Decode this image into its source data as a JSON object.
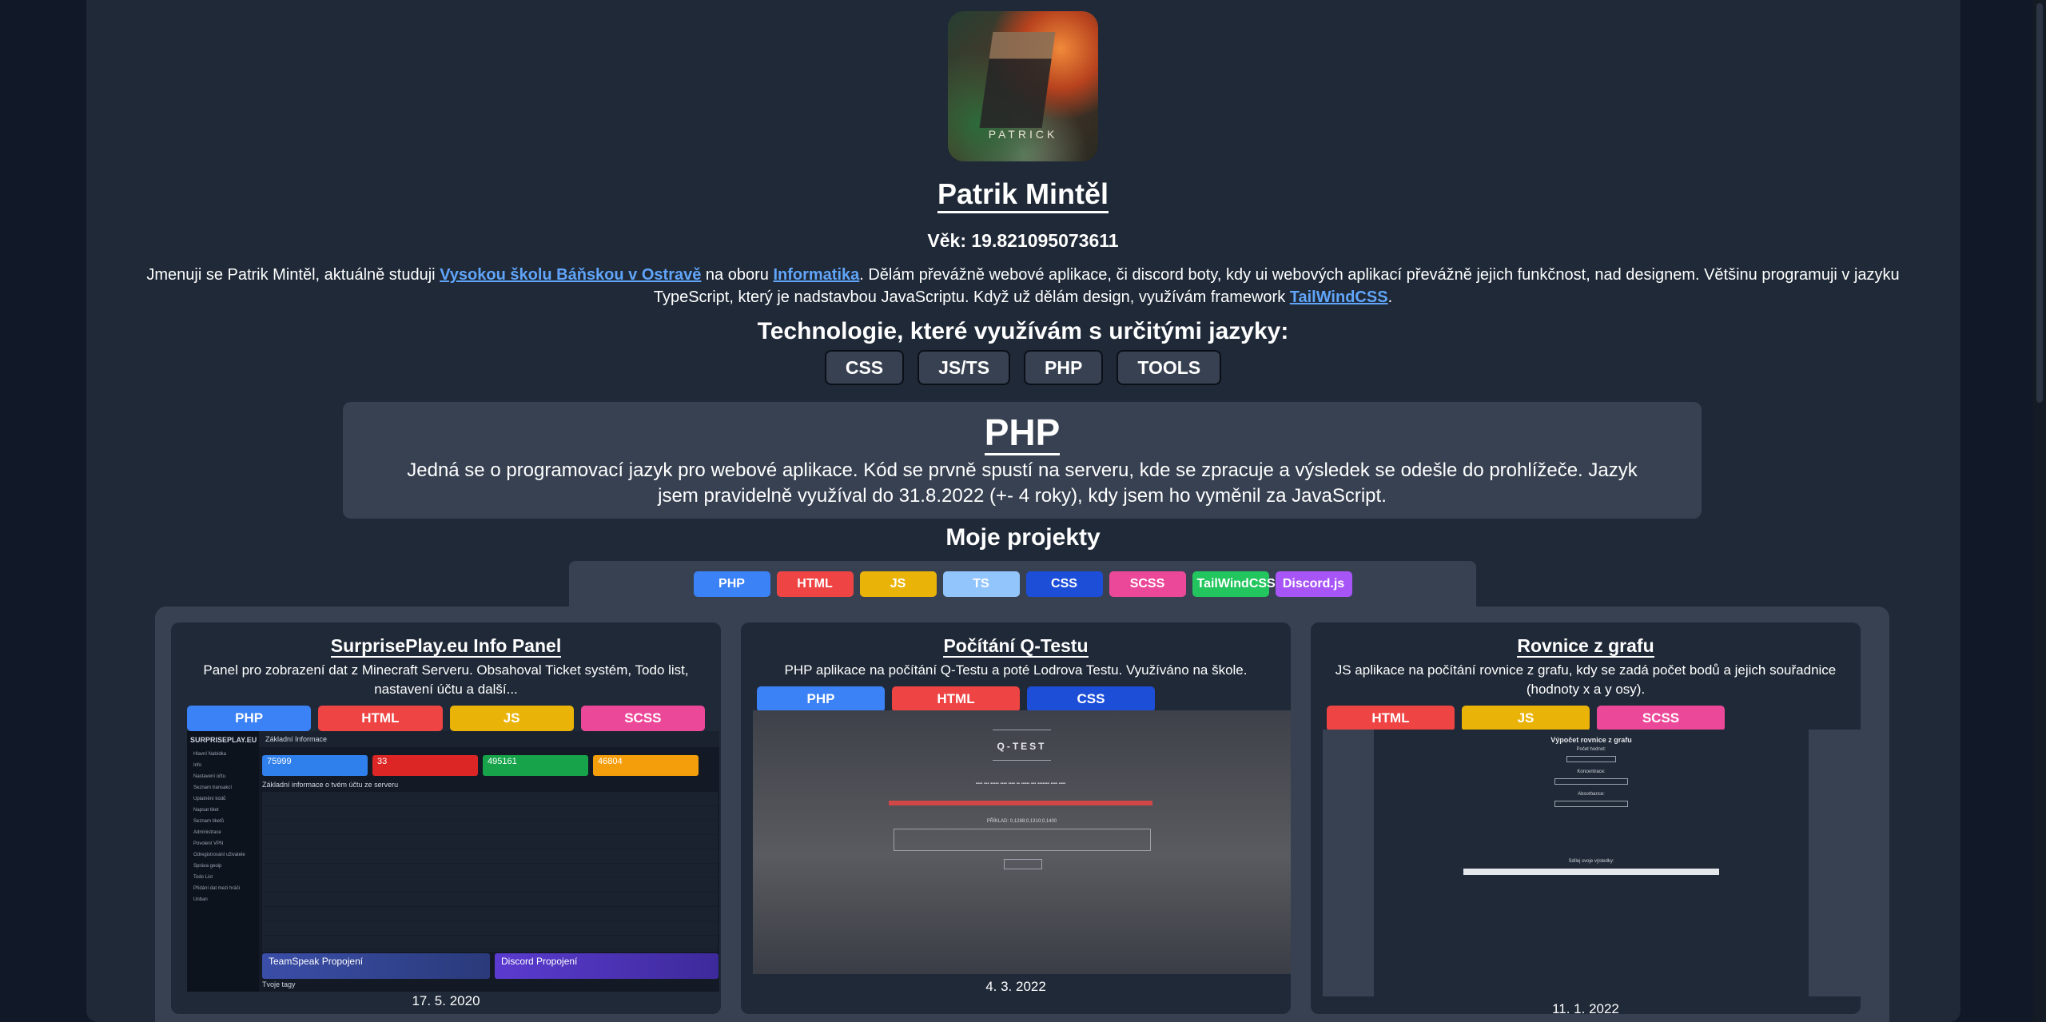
{
  "profile": {
    "avatar_caption": "PATRICK",
    "name": "Patrik Mintěl",
    "age_label": "Věk: 19.821095073611",
    "bio_part1": "Jmenuji se Patrik Mintěl, aktuálně studuji ",
    "bio_link1": "Vysokou školu Báňskou v Ostravě",
    "bio_part2": " na oboru ",
    "bio_link2": "Informatika",
    "bio_part3": ". Dělám převážně webové aplikace, či discord boty, kdy ui webových aplikací převážně jejich funkčnost, nad designem. Většinu programuji v jazyku TypeScript, který je nadstavbou JavaScriptu. Když už dělám design, využívám framework ",
    "bio_link3": "TailWindCSS",
    "bio_part4": "."
  },
  "technologies": {
    "title": "Technologie, které využívám s určitými jazyky:",
    "buttons": [
      "CSS",
      "JS/TS",
      "PHP",
      "TOOLS"
    ]
  },
  "selected_tech": {
    "title": "PHP",
    "description": "Jedná se o programovací jazyk pro webové aplikace. Kód se prvně spustí na serveru, kde se zpracuje a výsledek se odešle do prohlížeče. Jazyk jsem pravidelně využíval do 31.8.2022 (+- 4 roky), kdy jsem ho vyměnil za JavaScript."
  },
  "projects": {
    "title": "Moje projekty",
    "filters": [
      "PHP",
      "HTML",
      "JS",
      "TS",
      "CSS",
      "SCSS",
      "TailWindCSS",
      "Discord.js"
    ],
    "cards": [
      {
        "title": "SurprisePlay.eu Info Panel",
        "description": "Panel pro zobrazení dat z Minecraft Serveru. Obsahoval Ticket systém, Todo list, nastavení účtu a další...",
        "tags": [
          "PHP",
          "HTML",
          "JS",
          "SCSS"
        ],
        "date": "17. 5. 2020",
        "screenshot": {
          "brand": "SURPRISEPLAY.EU",
          "header": "Základní Informace",
          "menu": [
            "Hlavní Nabídka",
            "Info",
            "Nastavení účtu",
            "Seznam transakcí",
            "Uplatnění kódů",
            "Napsat tiket",
            "Seznam tiketů",
            "Administrace",
            "Povolení VPN",
            "Odregistrování uživatele",
            "Správa geoip",
            "Todo List",
            "Přidání dat mezi hráči",
            "Unban"
          ],
          "stats": [
            "75999",
            "33",
            "495161",
            "46804"
          ],
          "info_title": "Základní informace o tvém účtu ze serveru",
          "teamspeak": "TeamSpeak Propojení",
          "discord": "Discord Propojení",
          "tags_label": "Tvoje tagy"
        }
      },
      {
        "title": "Počítání Q-Testu",
        "description": "PHP aplikace na počítání Q-Testu a poté Lodrova Testu. Využíváno na škole.",
        "tags": [
          "PHP",
          "HTML",
          "CSS"
        ],
        "date": "4. 3. 2022",
        "screenshot": {
          "title": "Q-TEST",
          "example": "PŘÍKLAD: 0,1288;0,1310;0,1400"
        }
      },
      {
        "title": "Rovnice z grafu",
        "description": "JS aplikace na počítání rovnice z grafu, kdy se zadá počet bodů a jejich souřadnice (hodnoty x a y osy).",
        "tags": [
          "HTML",
          "JS",
          "SCSS"
        ],
        "date": "11. 1. 2022",
        "screenshot": {
          "title": "Výpočet rovnice z grafu",
          "labels": [
            "Počet hodnot:",
            "Koncentrace:",
            "Absorbance:",
            "Sdílej svoje výsledky:"
          ]
        }
      }
    ]
  }
}
